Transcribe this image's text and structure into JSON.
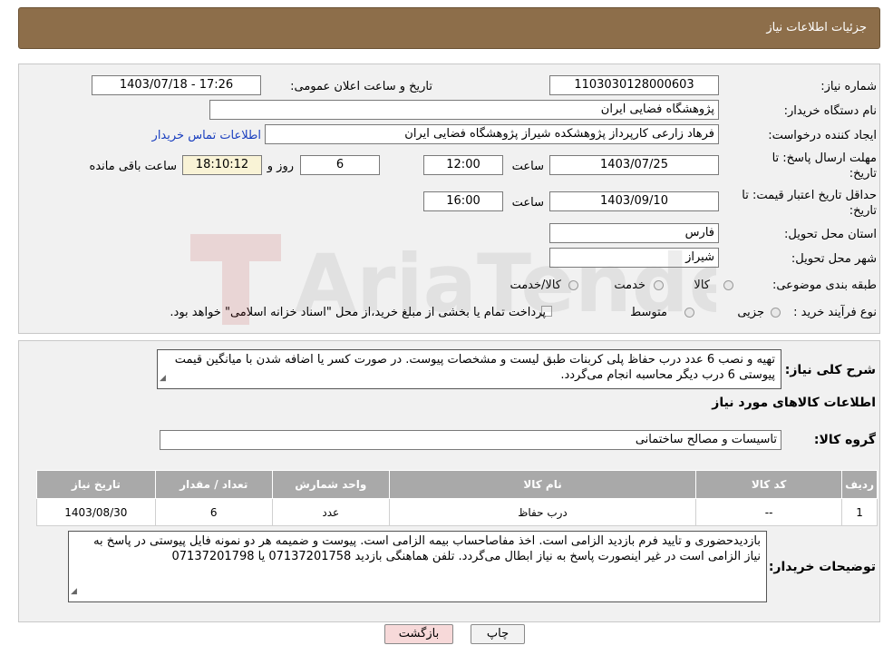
{
  "header": {
    "title": "جزئیات اطلاعات نیاز"
  },
  "form": {
    "need_number_label": "شماره نیاز:",
    "need_number": "1103030128000603",
    "announce_label": "تاریخ و ساعت اعلان عمومی:",
    "announce_value": "1403/07/18 - 17:26",
    "buyer_org_label": "نام دستگاه خریدار:",
    "buyer_org": "پژوهشگاه فضایی ایران",
    "creator_label": "ایجاد کننده درخواست:",
    "creator": "فرهاد زارعی کارپرداز پژوهشکده شیراز پژوهشگاه فضایی ایران",
    "contact_link": "اطلاعات تماس خریدار",
    "reply_deadline_label_1": "مهلت ارسال پاسخ: تا",
    "reply_deadline_label_2": "تاریخ:",
    "reply_date": "1403/07/25",
    "time_label": "ساعت",
    "reply_time": "12:00",
    "days_value": "6",
    "day_and_label": "روز و",
    "remaining_time": "18:10:12",
    "remaining_label": "ساعت باقی مانده",
    "price_validity_label_1": "حداقل تاریخ اعتبار قیمت: تا",
    "price_validity_label_2": "تاریخ:",
    "validity_date": "1403/09/10",
    "validity_time": "16:00",
    "province_label": "استان محل تحویل:",
    "province": "فارس",
    "city_label": "شهر محل تحویل:",
    "city": "شیراز",
    "category_label": "طبقه بندی موضوعی:",
    "category_options": [
      "کالا",
      "خدمت",
      "کالا/خدمت"
    ],
    "process_label": "نوع فرآیند خرید :",
    "process_options": [
      "جزیی",
      "متوسط"
    ],
    "process_note": "پرداخت تمام یا بخشی از مبلغ خرید،از محل \"اسناد خزانه اسلامی\" خواهد بود."
  },
  "description": {
    "label": "شرح کلی نیاز:",
    "text": "تهیه و نصب 6 عدد درب حفاظ  پلی کربنات  طبق لیست و مشخصات پیوست. در صورت کسر یا اضافه شدن با میانگین قیمت پیوستی 6 درب دیگر محاسبه انجام می‌گردد."
  },
  "goods": {
    "section_title": "اطلاعات کالاهای مورد نیاز",
    "group_label": "گروه کالا:",
    "group_value": "تاسیسات و مصالح ساختمانی",
    "columns": [
      "ردیف",
      "کد کالا",
      "نام کالا",
      "واحد شمارش",
      "تعداد / مقدار",
      "تاریخ نیاز"
    ],
    "rows": [
      [
        "1",
        "--",
        "درب حفاظ",
        "عدد",
        "6",
        "1403/08/30"
      ]
    ]
  },
  "buyer_notes": {
    "label": "توضیحات خریدار:",
    "text": "بازدیدحضوری و تایید فرم بازدید الزامی است. اخذ مفاصاحساب بیمه الزامی است. پیوست و ضمیمه هر دو نمونه فایل پیوستی در پاسخ به نیاز الزامی است در غیر اینصورت پاسخ به نیاز ابطال می‌گردد. تلفن هماهنگی بازدید 07137201758 یا 07137201798"
  },
  "buttons": {
    "print": "چاپ",
    "back": "بازگشت"
  },
  "watermark": {
    "text": "AriaTender.neT"
  },
  "colors": {
    "header": "#8d6e4a",
    "table_header": "#a9a9a9",
    "link": "#1a3fbf",
    "back_button": "#f7d9d9"
  }
}
